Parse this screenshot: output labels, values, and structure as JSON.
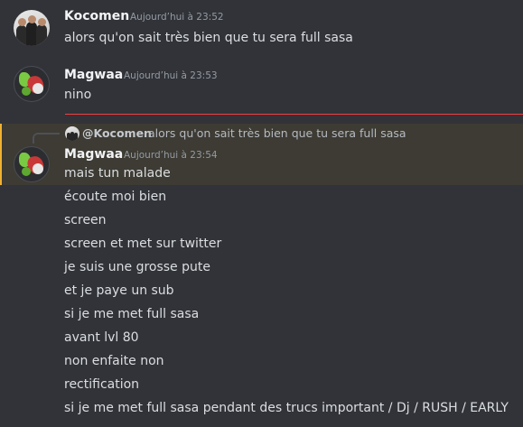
{
  "messages": [
    {
      "username": "Kocomen",
      "timestamp": "Aujourd’hui à 23:52",
      "lines": [
        "alors qu'on sait très bien que tu sera full sasa"
      ]
    },
    {
      "username": "Magwaa",
      "timestamp": "Aujourd’hui à 23:53",
      "lines": [
        "nino"
      ]
    },
    {
      "reply": {
        "author": "@Kocomen",
        "text": "alors qu'on sait très bien que tu sera full sasa"
      },
      "username": "Magwaa",
      "timestamp": "Aujourd’hui à 23:54",
      "lines": [
        "mais tun malade",
        "écoute moi bien",
        "screen",
        "screen et met sur twitter",
        "je suis une grosse pute",
        "et je paye un sub",
        "si je me met full sasa",
        "avant lvl 80",
        "non enfaite non",
        "rectification",
        "si je me met full sasa pendant des trucs important / Dj / RUSH / EARLY"
      ]
    }
  ],
  "colors": {
    "background": "#313338",
    "username": "#f2f3f5",
    "text": "#dbdee1",
    "timestamp": "#949ba4",
    "new_divider": "#f23f43",
    "mention_highlight_bg": "#3d3b33",
    "mention_highlight_bar": "#f0b232"
  }
}
